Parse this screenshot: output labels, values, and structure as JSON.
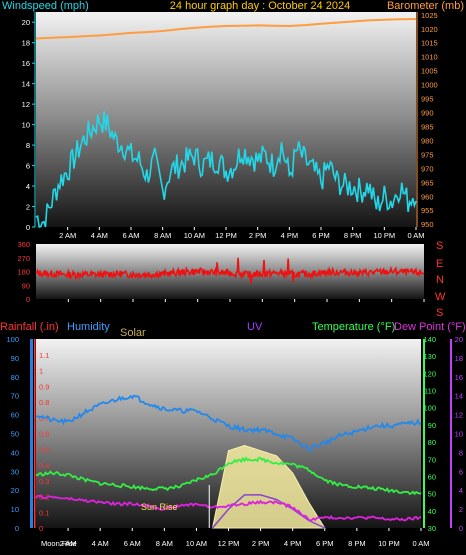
{
  "header": {
    "title": "24 hour graph day : October 24 2024",
    "windspeed_label": "Windspeed (mph)",
    "barometer_label": "Barometer (mb)"
  },
  "compass": [
    "S",
    "E",
    "N",
    "W",
    "S"
  ],
  "lower_labels": {
    "rainfall": "Rainfall (.in)",
    "humidity": "Humidity",
    "solar": "Solar",
    "uv": "UV",
    "temperature": "Temperature (°F)",
    "dewpoint": "Dew Point (°F)"
  },
  "annotations": {
    "sun_rise": "Sun Rise",
    "moon_rise": "Moon Rise"
  },
  "colors": {
    "wind": "#22d8e8",
    "barometer": "#ff9c40",
    "direction": "#ee1111",
    "humidity": "#2288ee",
    "temperature": "#33ee44",
    "dewpoint": "#dd22dd",
    "solar": "#f4eca0",
    "uv": "#8844cc",
    "rain_axis": "#ff3333",
    "humidity_axis": "#3aa0ff",
    "uv_axis": "#c040ff"
  },
  "chart_data": [
    {
      "type": "line",
      "title": "24 hour graph day : October 24 2024",
      "x_ticks": [
        "2 AM",
        "4 AM",
        "6 AM",
        "8 AM",
        "10 AM",
        "12 PM",
        "2 PM",
        "4 PM",
        "6 PM",
        "8 PM",
        "10 PM",
        "0 AM"
      ],
      "xlim": [
        0,
        24
      ],
      "left_axis": {
        "label": "Windspeed (mph)",
        "ylim": [
          0,
          21
        ],
        "ticks": [
          0,
          2,
          4,
          6,
          8,
          10,
          12,
          14,
          16,
          18,
          20
        ]
      },
      "right_axis": {
        "label": "Barometer (mb)",
        "ylim": [
          949,
          1026
        ],
        "ticks": [
          950,
          955,
          960,
          965,
          970,
          975,
          980,
          985,
          990,
          995,
          1000,
          1005,
          1010,
          1015,
          1020,
          1025
        ]
      },
      "series": [
        {
          "axis": "left",
          "x": [
            0,
            0.5,
            1,
            1.5,
            2,
            2.5,
            3,
            3.5,
            4,
            4.5,
            5,
            5.5,
            6,
            6.5,
            7,
            7.5,
            8,
            8.5,
            9,
            9.5,
            10,
            10.5,
            11,
            11.5,
            12,
            12.5,
            13,
            13.5,
            14,
            14.5,
            15,
            15.5,
            16,
            16.5,
            17,
            17.5,
            18,
            18.5,
            19,
            19.5,
            20,
            20.5,
            21,
            21.5,
            22,
            22.5,
            23,
            23.5,
            24
          ],
          "values": [
            1,
            0.5,
            2.5,
            4.5,
            5.5,
            7,
            8.5,
            9.5,
            10.5,
            10,
            8.5,
            8,
            7,
            6.5,
            5,
            6.5,
            3.5,
            5.5,
            6,
            6.5,
            7,
            6,
            6.5,
            6.5,
            5.5,
            6,
            7.5,
            7,
            6.5,
            7,
            6,
            8,
            5,
            7.5,
            6.5,
            5.5,
            4.5,
            6,
            4.5,
            4,
            4,
            3.5,
            4,
            2,
            3,
            2.5,
            4,
            2.5,
            3.5
          ]
        },
        {
          "axis": "right",
          "x": [
            0,
            1,
            2,
            3,
            4,
            5,
            6,
            7,
            8,
            9,
            10,
            11,
            12,
            13,
            14,
            15,
            16,
            17,
            18,
            19,
            20,
            21,
            22,
            23,
            24
          ],
          "values": [
            1016.5,
            1016.8,
            1017,
            1017.3,
            1017.6,
            1018,
            1018.5,
            1018.8,
            1019.2,
            1019.8,
            1020.3,
            1020.7,
            1021,
            1021.1,
            1021.2,
            1021.1,
            1021,
            1021.3,
            1021.8,
            1022.2,
            1022.6,
            1023,
            1023.2,
            1023.4,
            1023.5
          ]
        }
      ]
    },
    {
      "type": "line",
      "x_ticks": [
        "2 AM",
        "4 AM",
        "6 AM",
        "8 AM",
        "10 AM",
        "12 PM",
        "2 PM",
        "4 PM",
        "6 PM",
        "8 PM",
        "10 PM",
        "0 AM"
      ],
      "xlim": [
        0,
        24
      ],
      "left_axis": {
        "ylim": [
          0,
          360
        ],
        "ticks": [
          0,
          90,
          180,
          270,
          360
        ],
        "tick_labels": [
          "0",
          "90",
          "180",
          "270",
          "360"
        ]
      },
      "right_axis": {
        "tick_labels": [
          "S",
          "E",
          "N",
          "W",
          "S"
        ]
      },
      "series": [
        {
          "x": [
            0,
            1,
            2,
            3,
            4,
            5,
            6,
            7,
            8,
            9,
            10,
            11,
            12,
            13,
            14,
            15,
            16,
            17,
            18,
            19,
            20,
            21,
            22,
            23,
            24
          ],
          "values": [
            170,
            165,
            160,
            160,
            160,
            165,
            160,
            160,
            165,
            175,
            180,
            175,
            170,
            160,
            165,
            170,
            160,
            165,
            175,
            175,
            170,
            175,
            180,
            175,
            170
          ]
        }
      ]
    },
    {
      "type": "line",
      "x_ticks": [
        "2 AM",
        "4 AM",
        "6 AM",
        "8 AM",
        "10 AM",
        "12 PM",
        "2 PM",
        "4 PM",
        "6 PM",
        "8 PM",
        "10 PM",
        "0 AM"
      ],
      "xlim": [
        0,
        24
      ],
      "axes": {
        "rainfall": {
          "label": "Rainfall (.in)",
          "ylim": [
            0,
            1.2
          ],
          "ticks": [
            0,
            0.1,
            0.2,
            0.3,
            0.4,
            0.5,
            0.6,
            0.7,
            0.8,
            0.9,
            1,
            1.1
          ]
        },
        "humidity": {
          "label": "Humidity",
          "ylim": [
            0,
            100
          ],
          "ticks": [
            0,
            10,
            20,
            30,
            40,
            50,
            60,
            70,
            80,
            90,
            100
          ]
        },
        "temperature": {
          "label": "Temperature (°F)",
          "ylim": [
            30,
            140
          ],
          "ticks": [
            30,
            40,
            50,
            60,
            70,
            80,
            90,
            100,
            110,
            120,
            130,
            140
          ]
        },
        "uv": {
          "label": "UV",
          "ylim": [
            0,
            20
          ],
          "ticks": [
            0,
            2,
            4,
            6,
            8,
            10,
            12,
            14,
            16,
            18,
            20
          ]
        }
      },
      "series": [
        {
          "name": "Humidity",
          "axis": "humidity",
          "x": [
            0,
            1,
            2,
            3,
            4,
            5,
            6,
            7,
            8,
            9,
            10,
            11,
            12,
            13,
            14,
            15,
            16,
            17,
            18,
            19,
            20,
            21,
            22,
            23,
            24
          ],
          "values": [
            60,
            57,
            56,
            61,
            65,
            68,
            70,
            66,
            63,
            62,
            62,
            58,
            54,
            52,
            52,
            50,
            47,
            42,
            45,
            49,
            51,
            54,
            54,
            55,
            56
          ]
        },
        {
          "name": "Temperature",
          "axis": "temperature",
          "x": [
            0,
            1,
            2,
            3,
            4,
            5,
            6,
            7,
            8,
            9,
            10,
            11,
            12,
            13,
            14,
            15,
            16,
            17,
            18,
            19,
            20,
            21,
            22,
            23,
            24
          ],
          "values": [
            61,
            62,
            61,
            58,
            56,
            55,
            54,
            53,
            53,
            54,
            58,
            61,
            68,
            70,
            70,
            68,
            67,
            64,
            58,
            55,
            54,
            53,
            52,
            51,
            50
          ]
        },
        {
          "name": "Dew Point",
          "axis": "temperature",
          "x": [
            0,
            1,
            2,
            3,
            4,
            5,
            6,
            7,
            8,
            9,
            10,
            11,
            12,
            13,
            14,
            15,
            16,
            17,
            18,
            19,
            20,
            21,
            22,
            23,
            24
          ],
          "values": [
            48,
            48,
            47,
            46,
            45,
            44,
            44,
            43,
            41,
            43,
            44,
            42,
            43,
            44,
            45,
            45,
            42,
            35,
            36,
            36,
            36,
            36,
            35,
            35,
            36
          ]
        },
        {
          "name": "Solar",
          "axis": "temperature",
          "x": [
            11,
            12,
            13,
            14,
            15,
            16,
            17,
            18
          ],
          "values": [
            30,
            75,
            78,
            75,
            72,
            62,
            45,
            30
          ]
        },
        {
          "name": "UV",
          "axis": "uv",
          "x": [
            11,
            12,
            13,
            14,
            15,
            16,
            17,
            18
          ],
          "values": [
            0,
            2,
            3.5,
            3.5,
            3,
            2,
            0.8,
            0
          ]
        }
      ]
    }
  ]
}
